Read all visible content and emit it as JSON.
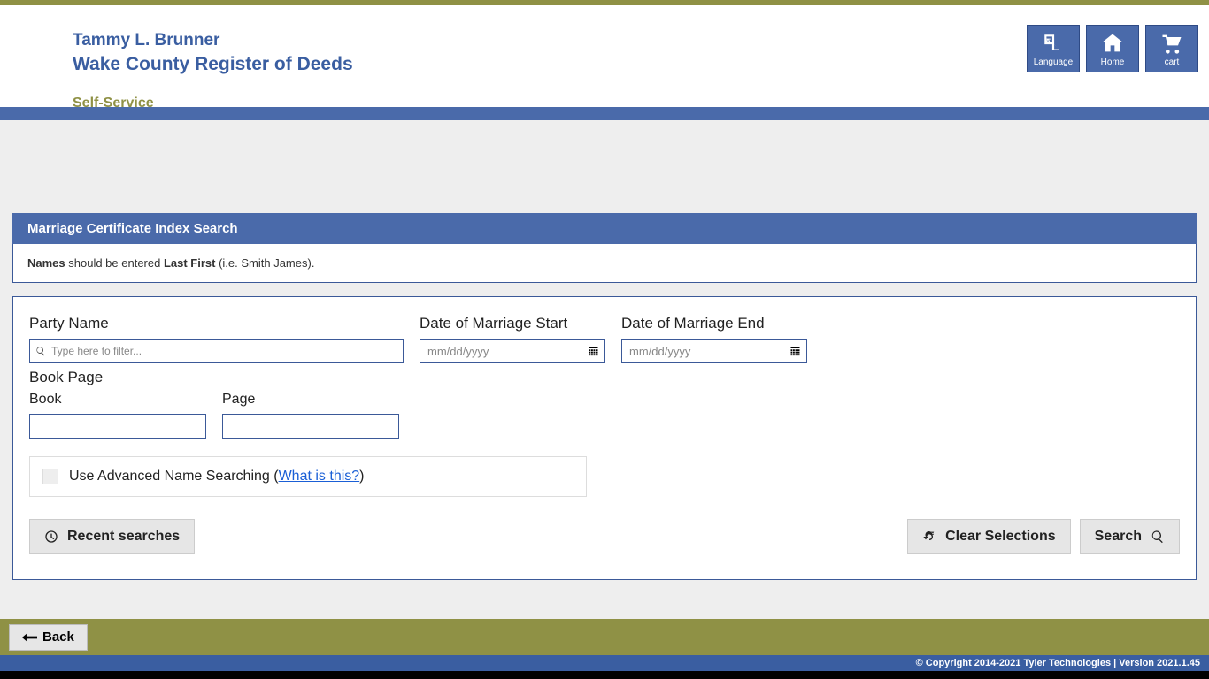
{
  "header": {
    "person_name": "Tammy L. Brunner",
    "office_title": "Wake County Register of Deeds",
    "subtitle": "Self-Service",
    "buttons": {
      "language": "Language",
      "home": "Home",
      "cart": "cart"
    }
  },
  "panel": {
    "title": "Marriage Certificate Index Search",
    "note_prefix": "Names",
    "note_mid": " should be entered ",
    "note_bold2": "Last First",
    "note_suffix": " (i.e. Smith James)."
  },
  "fields": {
    "party_name_label": "Party Name",
    "party_name_placeholder": "Type here to filter...",
    "date_start_label": "Date of Marriage Start",
    "date_end_label": "Date of Marriage End",
    "date_placeholder": "mm/dd/yyyy",
    "bookpage_title": "Book Page",
    "book_label": "Book",
    "page_label": "Page"
  },
  "advanced": {
    "prefix": "Use Advanced Name Searching (",
    "link": "What is this?",
    "suffix": ")"
  },
  "buttons": {
    "recent": "Recent searches",
    "clear": "Clear Selections",
    "search": "Search",
    "back": "Back"
  },
  "footer": {
    "copyright": "© Copyright 2014-2021 Tyler Technologies | Version 2021.1.45"
  }
}
